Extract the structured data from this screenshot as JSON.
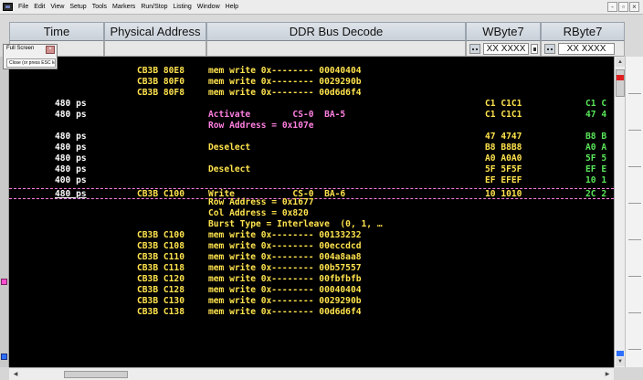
{
  "menubar": {
    "items": [
      "File",
      "Edit",
      "View",
      "Setup",
      "Tools",
      "Markers",
      "Run/Stop",
      "Listing",
      "Window",
      "Help"
    ],
    "win_buttons": [
      "-",
      "▫",
      "×"
    ]
  },
  "popup": {
    "title": "Full Screen",
    "close_label": "Close (or press ESC key)",
    "x_label": "×"
  },
  "columns": {
    "time": "Time",
    "physical_address": "Physical Address",
    "ddr_bus_decode": "DDR Bus Decode",
    "wbyte": "WByte7",
    "rbyte": "RByte7"
  },
  "filters": {
    "wbyte_value": "XX XXXX",
    "rbyte_value": "XX XXXX"
  },
  "rows": [
    {
      "time": "",
      "addr": "CB3B 80E8",
      "decode": "mem write 0x-------- 00040404",
      "w": "",
      "r": "",
      "tone": "yellow"
    },
    {
      "time": "",
      "addr": "CB3B 80F0",
      "decode": "mem write 0x-------- 0029290b",
      "w": "",
      "r": "",
      "tone": "yellow"
    },
    {
      "time": "",
      "addr": "CB3B 80F8",
      "decode": "mem write 0x-------- 00d6d6f4",
      "w": "",
      "r": "",
      "tone": "yellow"
    },
    {
      "time": "480 ps",
      "addr": "",
      "decode": "",
      "w": "C1 C1C1",
      "r": "C1 C",
      "tone": "yellow"
    },
    {
      "time": "480 ps",
      "addr": "",
      "decode": "Activate        CS-0  BA-5",
      "w": "C1 C1C1",
      "r": "47 4",
      "tone": "pink"
    },
    {
      "time": "",
      "addr": "",
      "decode": "Row Address = 0x107e",
      "w": "",
      "r": "",
      "tone": "pink"
    },
    {
      "time": "480 ps",
      "addr": "",
      "decode": "",
      "w": "47 4747",
      "r": "B8 B",
      "tone": "yellow"
    },
    {
      "time": "480 ps",
      "addr": "",
      "decode": "Deselect",
      "w": "B8 B8B8",
      "r": "A0 A",
      "tone": "yellow"
    },
    {
      "time": "480 ps",
      "addr": "",
      "decode": "",
      "w": "A0 A0A0",
      "r": "5F 5",
      "tone": "yellow"
    },
    {
      "time": "480 ps",
      "addr": "",
      "decode": "Deselect",
      "w": "5F 5F5F",
      "r": "EF E",
      "tone": "yellow"
    },
    {
      "time": "400 ps",
      "addr": "",
      "decode": "",
      "w": "EF EFEF",
      "r": "10 1",
      "tone": "yellow"
    },
    {
      "time": "480 ps",
      "addr": "CB3B C100",
      "decode": "Write           CS-0  BA-6",
      "w": "10 1010",
      "r": "2C 2",
      "tone": "yellow",
      "selected": true
    },
    {
      "time": "",
      "addr": "",
      "decode": "Row Address = 0x1677",
      "w": "",
      "r": "",
      "tone": "yellow"
    },
    {
      "time": "",
      "addr": "",
      "decode": "Col Address = 0x820",
      "w": "",
      "r": "",
      "tone": "yellow"
    },
    {
      "time": "",
      "addr": "",
      "decode": "Burst Type = Interleave  (0, 1, …",
      "w": "",
      "r": "",
      "tone": "yellow"
    },
    {
      "time": "",
      "addr": "CB3B C100",
      "decode": "mem write 0x-------- 00133232",
      "w": "",
      "r": "",
      "tone": "yellow"
    },
    {
      "time": "",
      "addr": "CB3B C108",
      "decode": "mem write 0x-------- 00eccdcd",
      "w": "",
      "r": "",
      "tone": "yellow"
    },
    {
      "time": "",
      "addr": "CB3B C110",
      "decode": "mem write 0x-------- 004a8aa8",
      "w": "",
      "r": "",
      "tone": "yellow"
    },
    {
      "time": "",
      "addr": "CB3B C118",
      "decode": "mem write 0x-------- 00b57557",
      "w": "",
      "r": "",
      "tone": "yellow"
    },
    {
      "time": "",
      "addr": "CB3B C120",
      "decode": "mem write 0x-------- 00fbfbfb",
      "w": "",
      "r": "",
      "tone": "yellow"
    },
    {
      "time": "",
      "addr": "CB3B C128",
      "decode": "mem write 0x-------- 00040404",
      "w": "",
      "r": "",
      "tone": "yellow"
    },
    {
      "time": "",
      "addr": "CB3B C130",
      "decode": "mem write 0x-------- 0029290b",
      "w": "",
      "r": "",
      "tone": "yellow"
    },
    {
      "time": "",
      "addr": "CB3B C138",
      "decode": "mem write 0x-------- 00d6d6f4",
      "w": "",
      "r": "",
      "tone": "yellow"
    }
  ],
  "colors": {
    "background": "#000000",
    "time_text": "#ffffff",
    "decode_yellow": "#ffe34d",
    "decode_pink": "#ff7fe0",
    "rbyte_green": "#59e659",
    "marker_pink": "#ff4fd0",
    "marker_blue": "#2e6fff",
    "marker_red": "#e02020"
  },
  "icons": {
    "app": "app-logo-icon",
    "filter_menu": "filter-menu-icon",
    "filter_toggle": "filter-toggle-icon",
    "scroll_up": "arrow-up-icon",
    "scroll_down": "arrow-down-icon",
    "scroll_left": "arrow-left-icon",
    "scroll_right": "arrow-right-icon"
  }
}
